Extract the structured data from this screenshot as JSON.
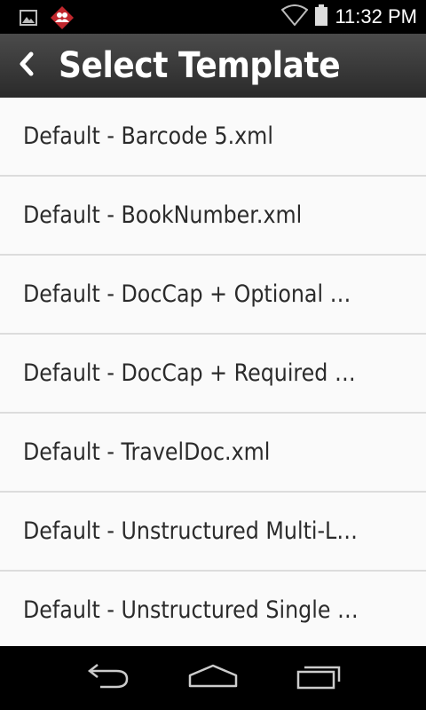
{
  "status_bar": {
    "time": "11:32 PM",
    "icons": [
      "image-notification-icon",
      "app-notification-icon",
      "wifi-icon",
      "battery-icon"
    ]
  },
  "app_bar": {
    "title": "Select Template",
    "back_icon": "chevron-left-icon"
  },
  "templates": [
    "Default - Barcode 5.xml",
    "Default - BookNumber.xml",
    "Default - DocCap + Optional Barco...",
    "Default - DocCap + Required Barc...",
    "Default - TravelDoc.xml",
    "Default - Unstructured Multi-Line....",
    "Default - Unstructured Single Line..."
  ],
  "nav_bar": {
    "icons": [
      "back-nav-icon",
      "home-nav-icon",
      "recent-apps-icon"
    ]
  },
  "colors": {
    "app_bar": "#3a3a3a",
    "list_bg": "#fafafa",
    "divider": "#dcdcdc",
    "text": "#2b2b2b"
  }
}
